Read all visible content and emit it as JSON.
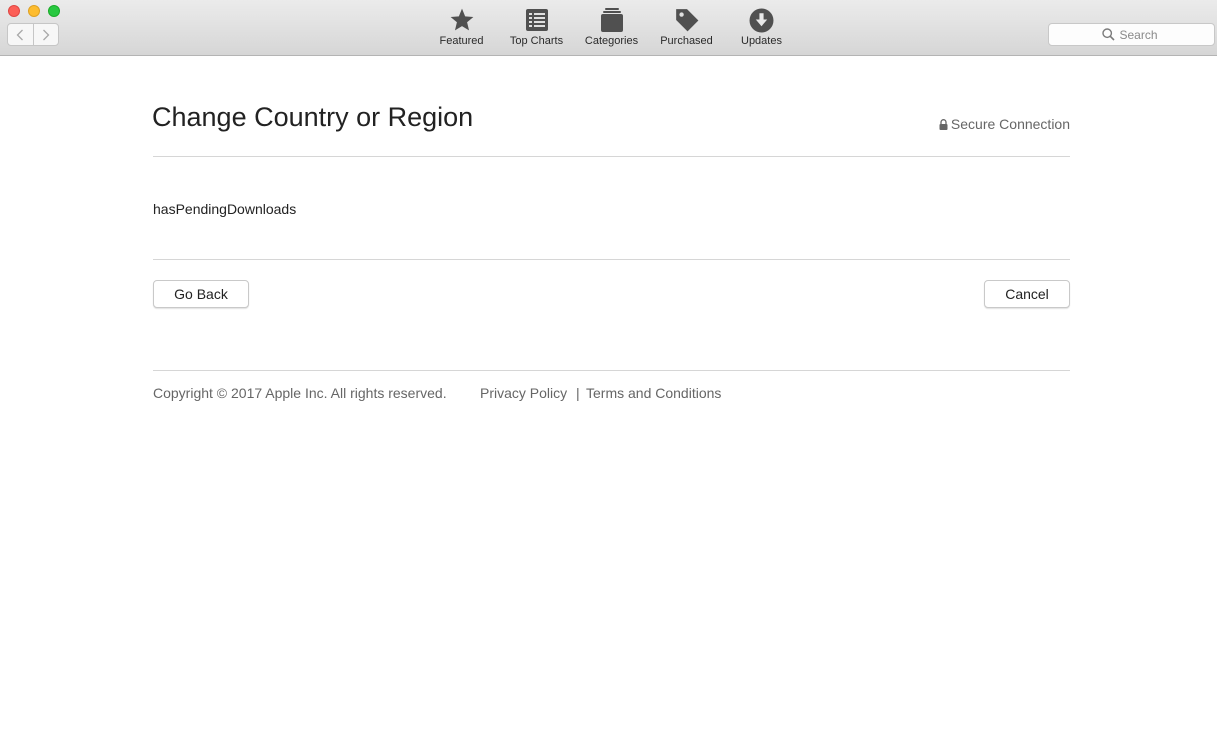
{
  "toolbar": {
    "tabs": [
      {
        "label": "Featured",
        "icon": "star-icon"
      },
      {
        "label": "Top Charts",
        "icon": "list-icon"
      },
      {
        "label": "Categories",
        "icon": "stack-icon"
      },
      {
        "label": "Purchased",
        "icon": "tag-icon"
      },
      {
        "label": "Updates",
        "icon": "download-arrow-icon"
      }
    ],
    "search": {
      "placeholder": "Search",
      "value": ""
    }
  },
  "page": {
    "title": "Change Country or Region",
    "secure_label": "Secure Connection",
    "message": "hasPendingDownloads"
  },
  "buttons": {
    "back": "Go Back",
    "cancel": "Cancel"
  },
  "footer": {
    "copyright": "Copyright © 2017 Apple Inc. All rights reserved.",
    "privacy": "Privacy Policy",
    "separator": "|",
    "terms": "Terms and Conditions"
  },
  "colors": {
    "close": "#fc5f57",
    "minimize": "#fdbc2e",
    "maximize": "#28c840",
    "icon": "#505050"
  }
}
